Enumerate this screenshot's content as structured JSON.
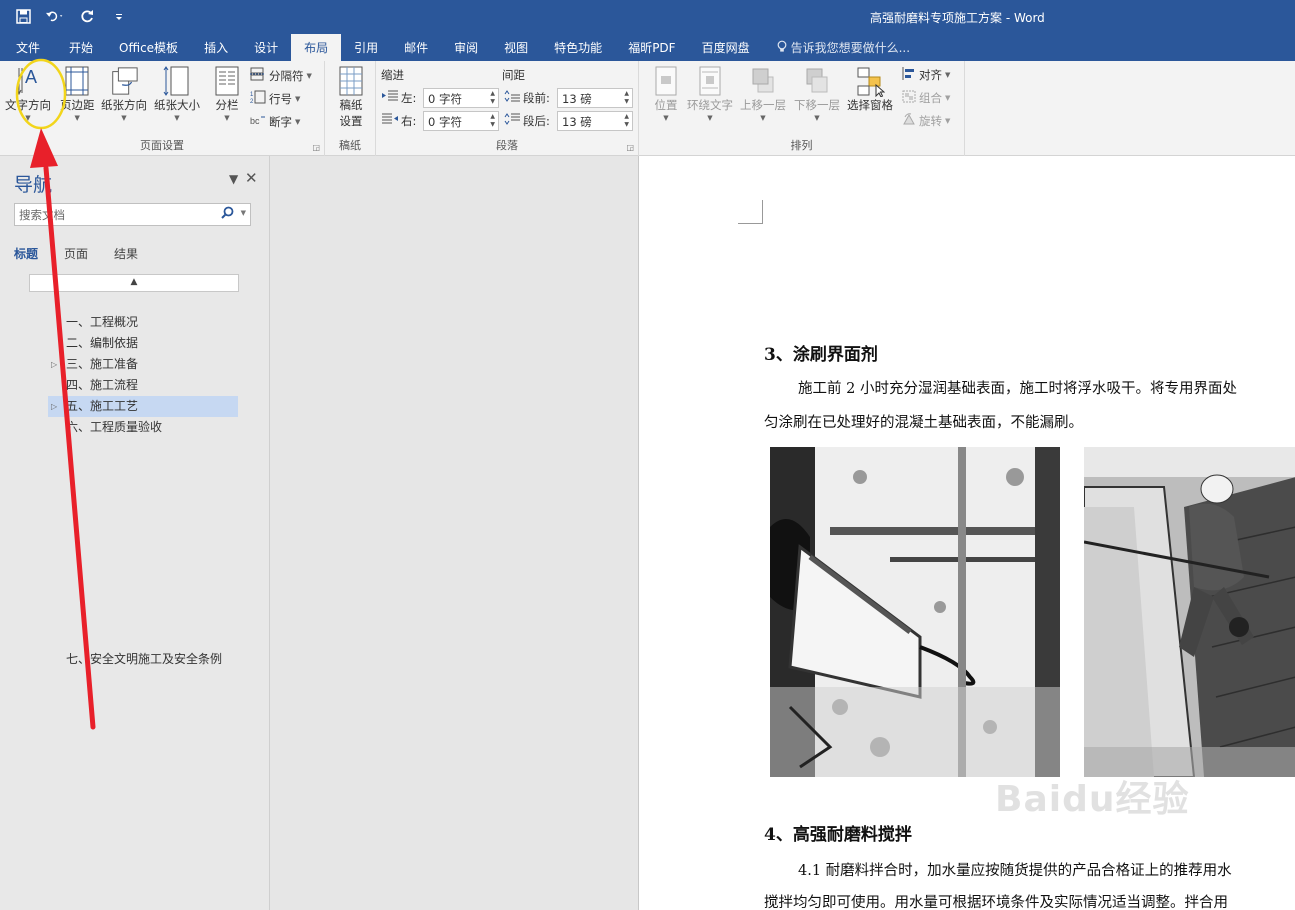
{
  "window": {
    "title": "高强耐磨料专项施工方案 - Word",
    "quick_access": [
      "save-icon",
      "undo-icon",
      "redo-icon",
      "customize-icon"
    ]
  },
  "ribbon": {
    "tabs": [
      "文件",
      "开始",
      "Office模板",
      "插入",
      "设计",
      "布局",
      "引用",
      "邮件",
      "审阅",
      "视图",
      "特色功能",
      "福昕PDF",
      "百度网盘"
    ],
    "active_tab": "布局",
    "tell_me": "告诉我您想要做什么...",
    "page_setup": {
      "label": "页面设置",
      "text_direction": "文字方向",
      "margins": "页边距",
      "orientation": "纸张方向",
      "size": "纸张大小",
      "columns": "分栏",
      "breaks": "分隔符",
      "line_numbers": "行号",
      "hyphenation": "断字"
    },
    "manuscript": {
      "label": "稿纸",
      "button_line1": "稿纸",
      "button_line2": "设置"
    },
    "paragraph": {
      "label": "段落",
      "indent_title": "缩进",
      "spacing_title": "间距",
      "indent_left_label": "左:",
      "indent_left_value": "0 字符",
      "indent_right_label": "右:",
      "indent_right_value": "0 字符",
      "spacing_before_label": "段前:",
      "spacing_before_value": "13 磅",
      "spacing_after_label": "段后:",
      "spacing_after_value": "13 磅"
    },
    "arrange": {
      "label": "排列",
      "position": "位置",
      "wrap_text": "环绕文字",
      "bring_forward": "上移一层",
      "send_backward": "下移一层",
      "selection_pane": "选择窗格",
      "align": "对齐",
      "group": "组合",
      "rotate": "旋转"
    }
  },
  "navigation": {
    "title": "导航",
    "search_placeholder": "搜索文档",
    "tabs": [
      "标题",
      "页面",
      "结果"
    ],
    "active_tab": "标题",
    "headings": [
      {
        "text": "一、工程概况",
        "expandable": false,
        "selected": false
      },
      {
        "text": "二、编制依据",
        "expandable": false,
        "selected": false
      },
      {
        "text": "三、施工准备",
        "expandable": true,
        "selected": false
      },
      {
        "text": "四、施工流程",
        "expandable": false,
        "selected": false
      },
      {
        "text": "五、施工工艺",
        "expandable": true,
        "selected": true
      },
      {
        "text": "六、工程质量验收",
        "expandable": false,
        "selected": false
      }
    ],
    "extra_heading": "七、安全文明施工及安全条例"
  },
  "document": {
    "heading3": "3、涂刷界面剂",
    "para3_line1": "施工前 2 小时充分湿润基础表面，施工时将浮水吸干。将专用界面处",
    "para3_line2": "匀涂刷在已处理好的混凝土基础表面，不能漏刷。",
    "heading4": "4、高强耐磨料搅拌",
    "para4_line1": "4.1 耐磨料拌合时，加水量应按随货提供的产品合格证上的推荐用水",
    "para4_line2": "搅拌均匀即可使用。用水量可根据环境条件及实际情况适当调整。拌合用"
  },
  "watermark": "Baidu经验",
  "colors": {
    "accent": "#2b579a",
    "annotation_arrow": "#e8202a",
    "annotation_circle": "#f2d51b"
  }
}
